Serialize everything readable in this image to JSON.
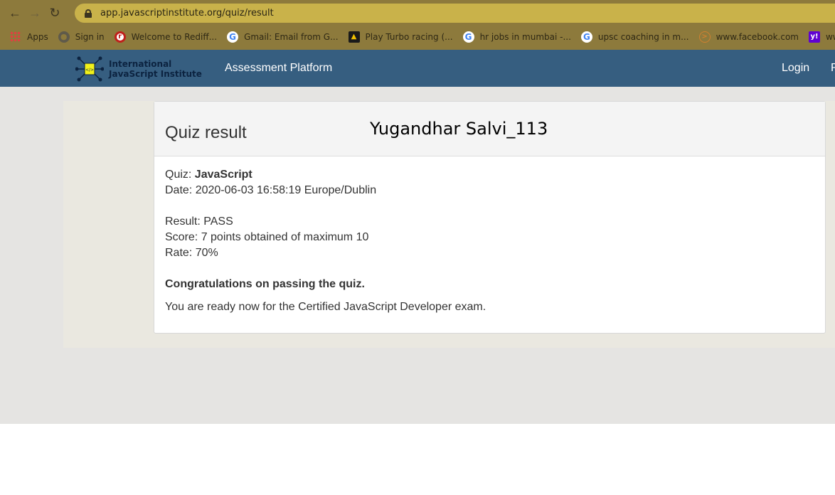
{
  "browser": {
    "url": "app.javascriptinstitute.org/quiz/result",
    "bookmarks": [
      {
        "label": "Apps",
        "icon": "apps-grid-icon"
      },
      {
        "label": "Sign in",
        "icon": "globe-icon"
      },
      {
        "label": "Welcome to Rediff...",
        "icon": "rediff-icon"
      },
      {
        "label": "Gmail: Email from G...",
        "icon": "google-icon"
      },
      {
        "label": "Play Turbo racing (...",
        "icon": "turbo-icon"
      },
      {
        "label": "hr jobs in mumbai -...",
        "icon": "google-icon"
      },
      {
        "label": "upsc coaching in m...",
        "icon": "google-icon"
      },
      {
        "label": "www.facebook.com",
        "icon": "facebook-icon"
      },
      {
        "label": "wwwrediffmail...",
        "icon": "yahoo-icon"
      }
    ]
  },
  "header": {
    "logo_line1": "International",
    "logo_line2": "JavaScript Institute",
    "brand": "Assessment Platform",
    "login": "Login",
    "more": "R"
  },
  "quiz": {
    "title": "Quiz result",
    "name_overlay": "Yugandhar Salvi_113",
    "quiz_label": "Quiz: ",
    "quiz_name": "JavaScript",
    "date": "Date: 2020-06-03 16:58:19 Europe/Dublin",
    "result": "Result: PASS",
    "score": "Score: 7 points obtained of maximum 10",
    "rate": "Rate: 70%",
    "congrats": "Congratulations on passing the quiz.",
    "ready": "You are ready now for the Certified JavaScript Developer exam."
  },
  "colors": {
    "chrome": "#8d7a3c",
    "omnibox": "#c9b24a",
    "header": "#365e80"
  }
}
